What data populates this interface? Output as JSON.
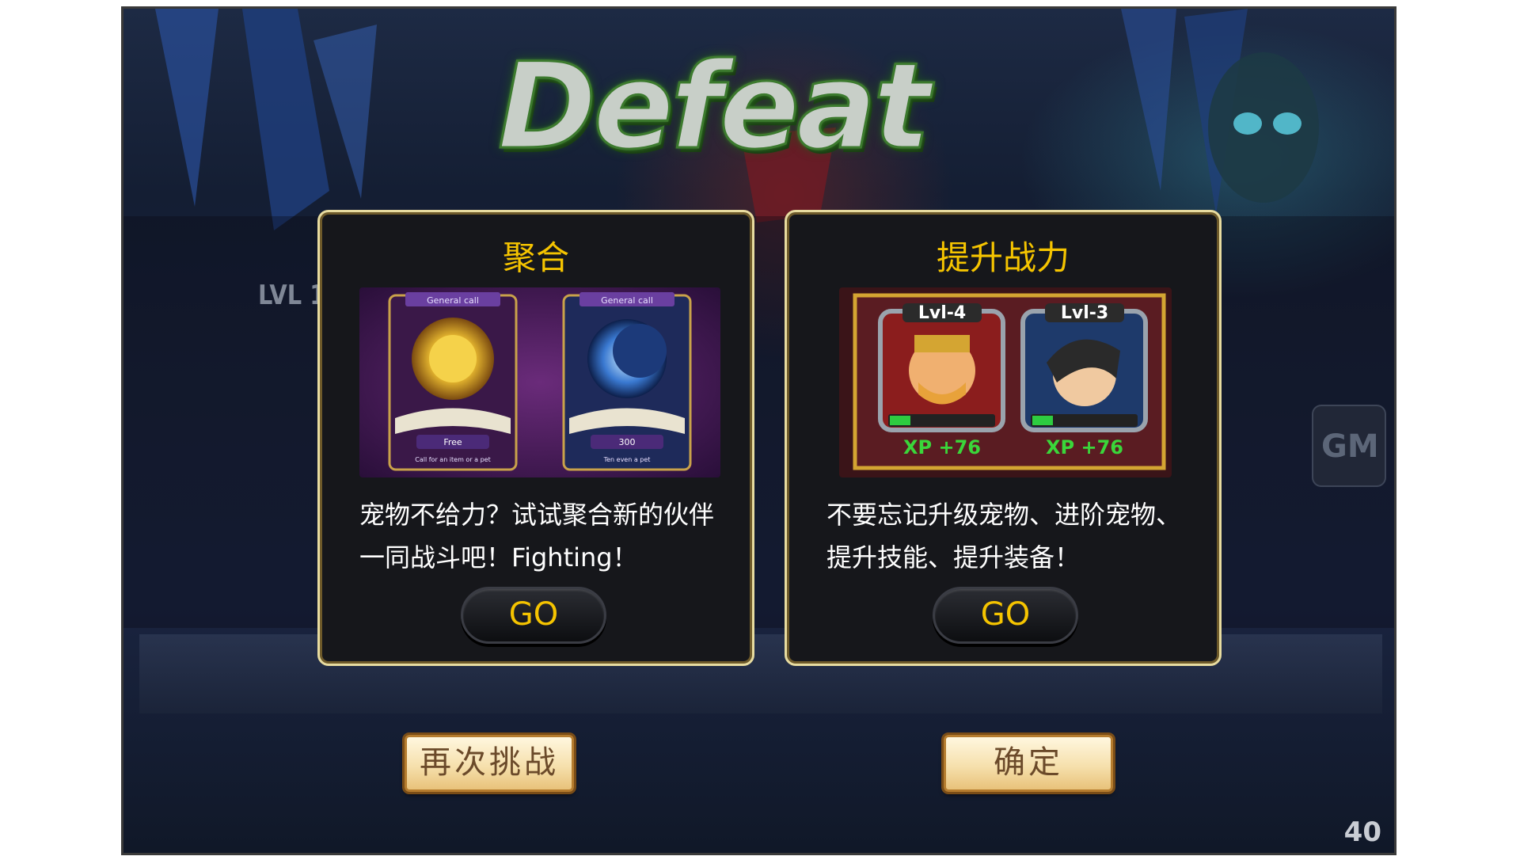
{
  "screen": {
    "title": "Defeat",
    "level_label": "LVL 1",
    "gm_label": "GM",
    "counter": "40"
  },
  "panels": [
    {
      "title": "聚合",
      "text": "宠物不给力？试试聚合新的伙伴一同战斗吧！Fighting！",
      "button": "GO",
      "cards": [
        {
          "header": "General call",
          "badge": "Free",
          "caption": "Call for an item or a pet"
        },
        {
          "header": "General call",
          "badge": "300",
          "caption": "Ten even a pet"
        }
      ]
    },
    {
      "title": "提升战力",
      "text": "不要忘记升级宠物、进阶宠物、提升技能、提升装备！",
      "button": "GO",
      "heroes": [
        {
          "level": "Lvl-4",
          "xp": "XP +76",
          "xp_fill": 0.2
        },
        {
          "level": "Lvl-3",
          "xp": "XP +76",
          "xp_fill": 0.2
        }
      ]
    }
  ],
  "buttons": {
    "retry": "再次挑战",
    "confirm": "确定"
  },
  "colors": {
    "accent_gold": "#f5c400",
    "panel_bg": "#16171b",
    "title_glow": "#3c7a2e"
  }
}
